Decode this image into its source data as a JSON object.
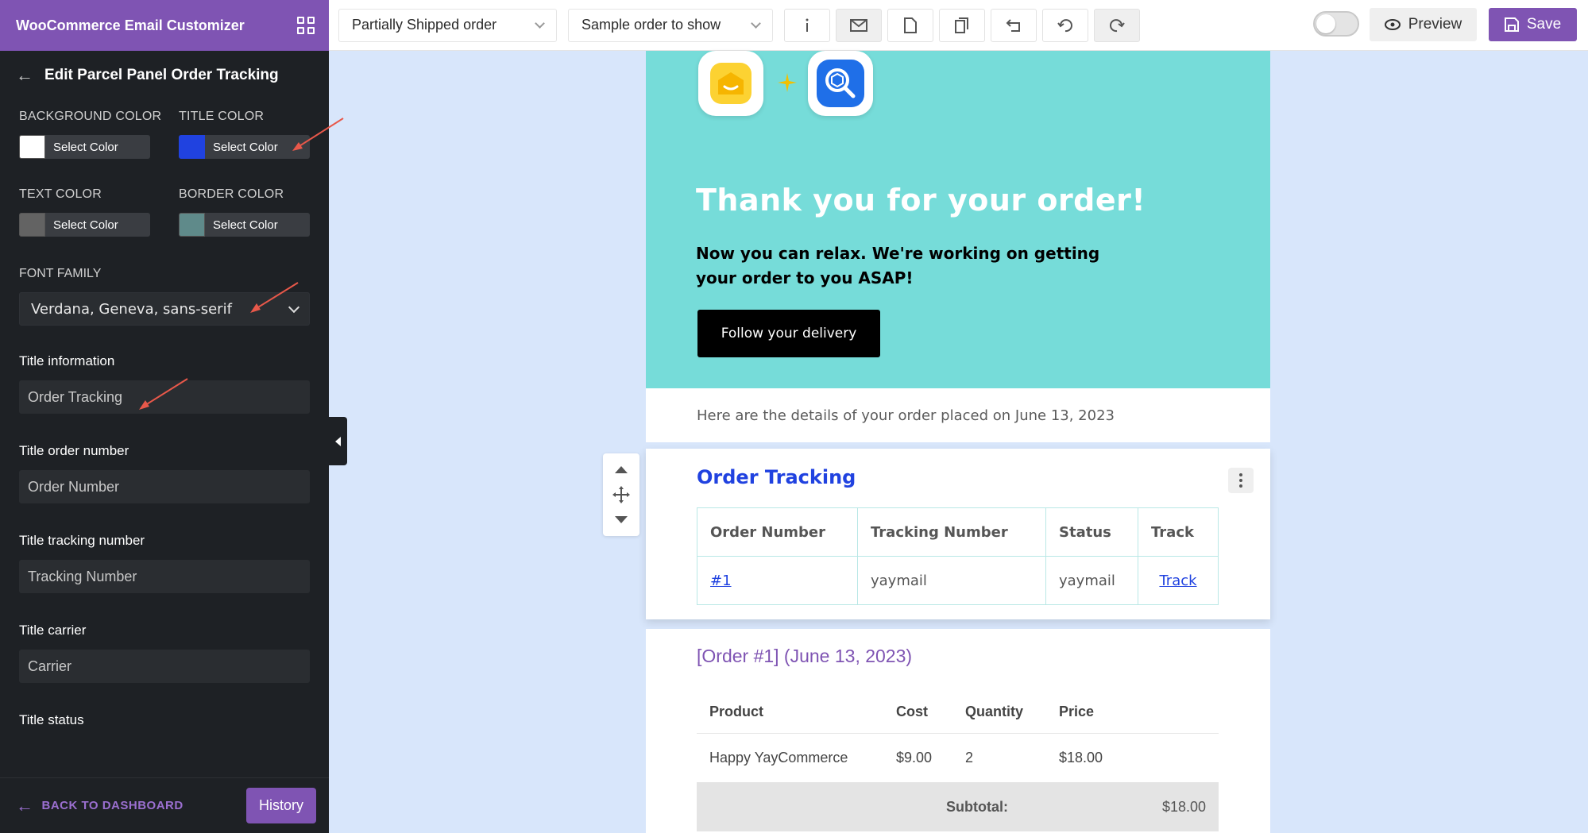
{
  "app": {
    "title": "WooCommerce Email Customizer"
  },
  "panel": {
    "title": "Edit Parcel Panel Order Tracking",
    "colors": [
      {
        "label": "BACKGROUND COLOR",
        "button": "Select Color",
        "value": "#ffffff"
      },
      {
        "label": "TITLE COLOR",
        "button": "Select Color",
        "value": "#2042e0"
      },
      {
        "label": "TEXT COLOR",
        "button": "Select Color",
        "value": "#636363"
      },
      {
        "label": "BORDER COLOR",
        "button": "Select Color",
        "value": "#5f8a8a"
      }
    ],
    "font_family": {
      "label": "FONT FAMILY",
      "value": "Verdana, Geneva, sans-serif"
    },
    "fields": [
      {
        "label": "Title information",
        "value": "Order Tracking"
      },
      {
        "label": "Title order number",
        "value": "Order Number"
      },
      {
        "label": "Title tracking number",
        "value": "Tracking Number"
      },
      {
        "label": "Title carrier",
        "value": "Carrier"
      },
      {
        "label": "Title status",
        "value": ""
      }
    ],
    "footer": {
      "back_label": "BACK TO DASHBOARD",
      "history_label": "History"
    }
  },
  "toolbar": {
    "email_type": "Partially Shipped order",
    "sample_order": "Sample order to show",
    "icons": [
      "info-icon",
      "email-icon",
      "document-icon",
      "copy-icon",
      "reset-icon",
      "undo-icon",
      "redo-icon"
    ],
    "preview_label": "Preview",
    "save_label": "Save"
  },
  "email": {
    "hero": {
      "title": "Thank you for your order!",
      "subtitle": "Now you can relax. We're working on getting your order to you ASAP!",
      "button": "Follow your delivery",
      "bg_color": "#76dcd9"
    },
    "details_text": "Here are the details of your order placed on June 13, 2023",
    "tracking": {
      "title": "Order Tracking",
      "columns": [
        "Order Number",
        "Tracking Number",
        "Status",
        "Track"
      ],
      "rows": [
        {
          "order": "#1",
          "tracking": "yaymail",
          "status": "yaymail",
          "track": "Track"
        }
      ]
    },
    "order": {
      "title": "[Order #1] (June 13, 2023)",
      "columns": [
        "Product",
        "Cost",
        "Quantity",
        "Price"
      ],
      "items": [
        {
          "product": "Happy YayCommerce",
          "cost": "$9.00",
          "quantity": "2",
          "price": "$18.00"
        }
      ],
      "subtotal_label": "Subtotal:",
      "subtotal_value": "$18.00"
    }
  },
  "accent_color": "#7f54b3"
}
